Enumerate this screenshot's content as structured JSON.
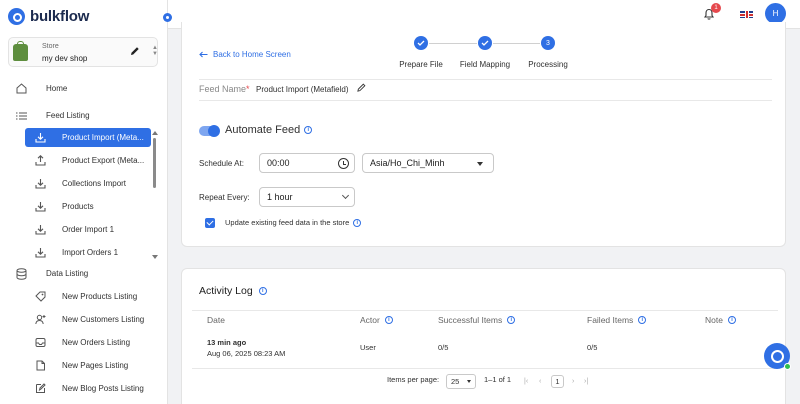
{
  "brand": {
    "name": "bulkflow",
    "accent": "#2f6fe4"
  },
  "store": {
    "label": "Store",
    "name": "my dev shop"
  },
  "sidebar": {
    "home": {
      "label": "Home",
      "icon": "home-icon"
    },
    "feed_listing": {
      "label": "Feed Listing",
      "icon": "list-icon"
    },
    "feed_items": [
      {
        "label": "Product Import (Meta...",
        "icon": "import-icon",
        "active": true
      },
      {
        "label": "Product Export (Meta...",
        "icon": "export-icon"
      },
      {
        "label": "Collections Import",
        "icon": "import-icon"
      },
      {
        "label": "Products",
        "icon": "import-icon"
      },
      {
        "label": "Order Import 1",
        "icon": "import-icon"
      },
      {
        "label": "Import Orders 1",
        "icon": "import-icon"
      }
    ],
    "data_listing": {
      "label": "Data Listing",
      "icon": "database-icon"
    },
    "data_items": [
      {
        "label": "New Products Listing",
        "icon": "product-icon"
      },
      {
        "label": "New Customers Listing",
        "icon": "customer-icon"
      },
      {
        "label": "New Orders Listing",
        "icon": "order-icon"
      },
      {
        "label": "New Pages Listing",
        "icon": "page-icon"
      },
      {
        "label": "New Blog Posts Listing",
        "icon": "blog-icon"
      }
    ]
  },
  "topbar": {
    "notification_count": "1",
    "language_flag": "uk-flag-icon",
    "avatar_initial": "H"
  },
  "wizard": {
    "back_label": "Back to Home Screen",
    "steps": [
      {
        "label": "Prepare File",
        "state": "done"
      },
      {
        "label": "Field Mapping",
        "state": "done"
      },
      {
        "label": "Processing",
        "number": "3",
        "state": "current"
      }
    ]
  },
  "feed": {
    "name_label": "Feed Name",
    "name_required_mark": "*",
    "name_value": "Product Import (Metafield)",
    "automate_label": "Automate Feed",
    "automate_enabled": true,
    "schedule_label": "Schedule At:",
    "schedule_time": "00:00",
    "timezone": "Asia/Ho_Chi_Minh",
    "repeat_label": "Repeat Every:",
    "repeat_value": "1 hour",
    "update_existing_label": "Update existing feed data in the store",
    "update_existing_checked": true
  },
  "activity_log": {
    "title": "Activity Log",
    "columns": [
      "Date",
      "Actor",
      "Successful Items",
      "Failed Items",
      "Note"
    ],
    "rows": [
      {
        "relative": "13 min ago",
        "date": "Aug 06, 2025 08:23 AM",
        "actor": "User",
        "successful": "0/5",
        "failed": "0/5",
        "note": ""
      }
    ],
    "pagination": {
      "per_page_label": "Items per page:",
      "per_page": "25",
      "range": "1–1 of 1",
      "current_page": "1"
    }
  }
}
